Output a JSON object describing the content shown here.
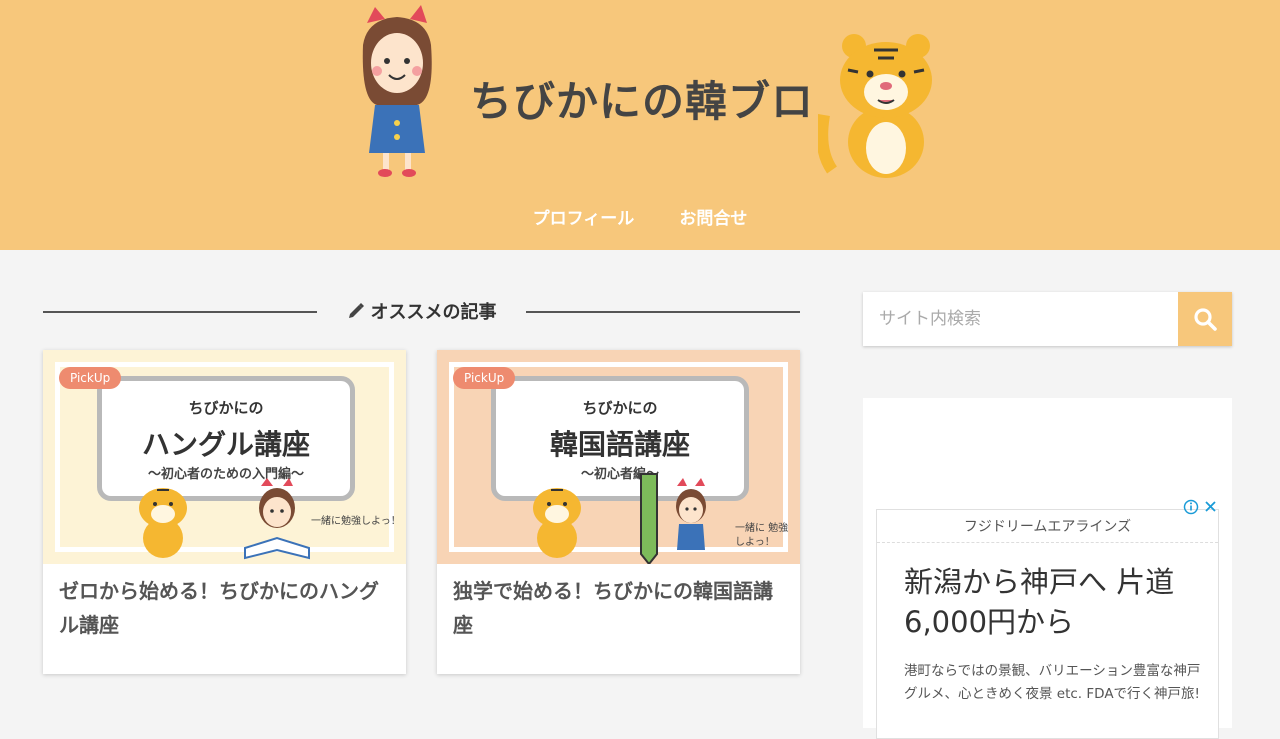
{
  "header": {
    "site_title": "ちびかにの韓ブロ",
    "bg_color": "#f7c77b",
    "nav": [
      "プロフィール",
      "お問合せ"
    ]
  },
  "section": {
    "heading": "オススメの記事",
    "icon": "pencil-icon"
  },
  "cards": [
    {
      "badge": "PickUp",
      "thumb_line1": "ちびかにの",
      "thumb_line2": "ハングル講座",
      "thumb_line3": "〜初心者のための入門編〜",
      "thumb_note": "一緒に勉強しよっ！",
      "thumb_bg": "#fdf3d6",
      "title": "ゼロから始める！ちびかにのハングル講座"
    },
    {
      "badge": "PickUp",
      "thumb_line1": "ちびかにの",
      "thumb_line2": "韓国語講座",
      "thumb_line3": "〜初心者編〜",
      "thumb_note": "一緒に 勉強しよっ！",
      "thumb_bg": "#f8d4b5",
      "title": "独学で始める！ちびかにの韓国語講座"
    }
  ],
  "sidebar": {
    "search_placeholder": "サイト内検索",
    "search_icon": "search-icon"
  },
  "ad": {
    "advertiser": "フジドリームエアラインズ",
    "headline": "新潟から神戸へ 片道6,000円から",
    "body": "港町ならではの景観、バリエーション豊富な神戸グルメ、心ときめく夜景 etc. FDAで行く神戸旅!"
  }
}
